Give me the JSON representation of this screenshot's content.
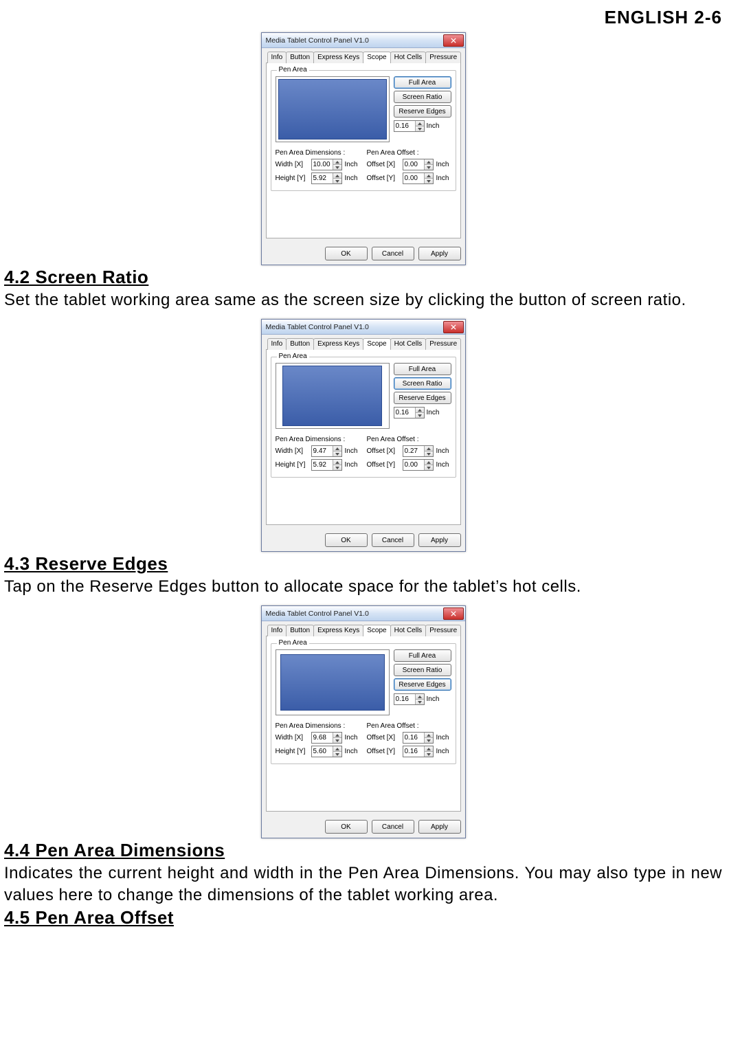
{
  "header": "ENGLISH 2-6",
  "sections": {
    "s42": {
      "heading": "4.2 Screen Ratio",
      "body": "Set the tablet working area same as the screen size by clicking the button of screen ratio."
    },
    "s43": {
      "heading": "4.3 Reserve Edges",
      "body": "Tap on the Reserve Edges button to allocate space for the tablet’s hot cells."
    },
    "s44": {
      "heading": "4.4 Pen Area Dimensions",
      "body": "Indicates the current height and width in the Pen Area Dimensions. You may also type in new values here to change the dimensions of the tablet working area."
    },
    "s45": {
      "heading": "4.5 Pen Area Offset"
    }
  },
  "dialog": {
    "title": "Media Tablet Control Panel V1.0",
    "tabs": [
      "Info",
      "Button",
      "Express Keys",
      "Scope",
      "Hot Cells",
      "Pressure"
    ],
    "groupLegend": "Pen Area",
    "sideButtons": {
      "full": "Full Area",
      "ratio": "Screen Ratio",
      "reserve": "Reserve Edges"
    },
    "inchLabel": "Inch",
    "dimsTitle": "Pen Area Dimensions :",
    "offsetTitle": "Pen Area Offset :",
    "widthLabel": "Width [X]",
    "heightLabel": "Height [Y]",
    "offXLabel": "Offset [X]",
    "offYLabel": "Offset [Y]",
    "buttons": {
      "ok": "OK",
      "cancel": "Cancel",
      "apply": "Apply"
    }
  },
  "fig1": {
    "selected": "full",
    "edge": "0.16",
    "width": "10.00",
    "height": "5.92",
    "offx": "0.00",
    "offy": "0.00"
  },
  "fig2": {
    "selected": "ratio",
    "edge": "0.16",
    "width": "9.47",
    "height": "5.92",
    "offx": "0.27",
    "offy": "0.00"
  },
  "fig3": {
    "selected": "reserve",
    "edge": "0.16",
    "width": "9.68",
    "height": "5.60",
    "offx": "0.16",
    "offy": "0.16"
  }
}
